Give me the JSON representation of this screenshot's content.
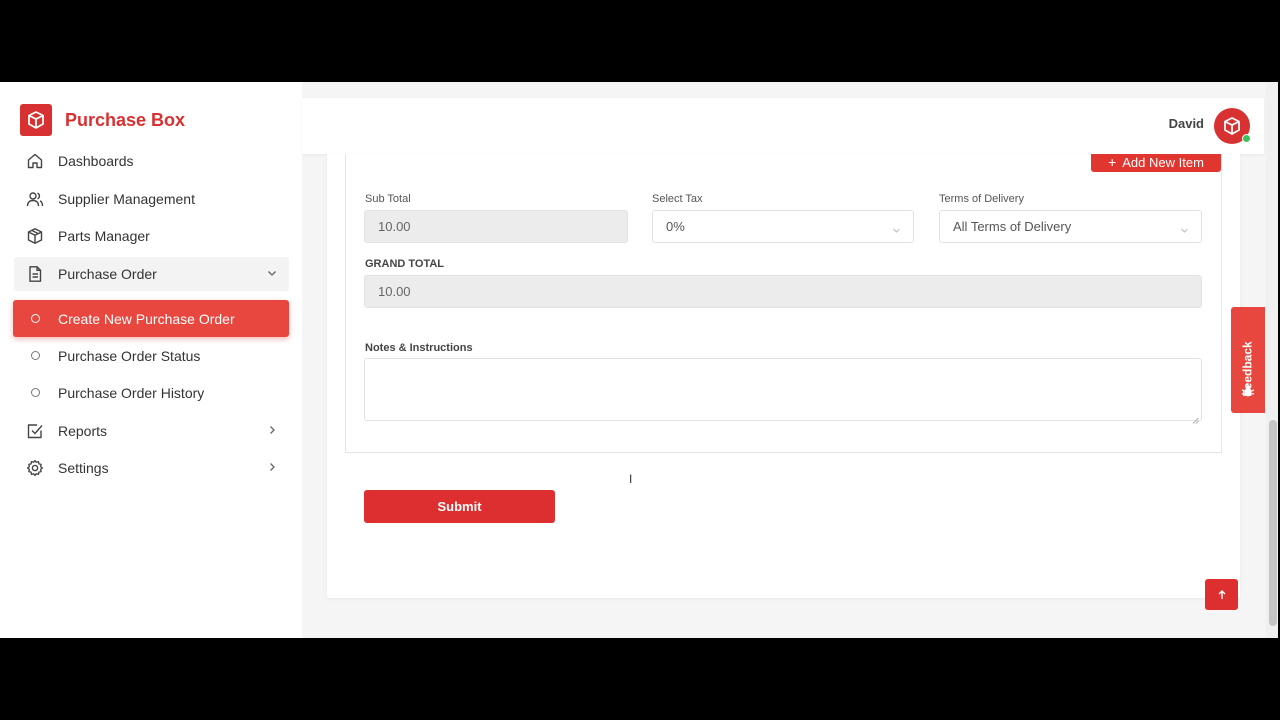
{
  "brand": {
    "name": "Purchase Box",
    "color": "#d83131"
  },
  "sidebar": {
    "items": [
      {
        "label": "Dashboards",
        "icon": "home-icon"
      },
      {
        "label": "Supplier Management",
        "icon": "users-icon"
      },
      {
        "label": "Parts Manager",
        "icon": "box-icon"
      },
      {
        "label": "Purchase Order",
        "icon": "document-icon",
        "expanded": true
      },
      {
        "label": "Reports",
        "icon": "checkbox-icon"
      },
      {
        "label": "Settings",
        "icon": "gear-icon"
      }
    ],
    "purchase_order_sub": [
      {
        "label": "Create New Purchase Order",
        "active": true
      },
      {
        "label": "Purchase Order Status",
        "active": false
      },
      {
        "label": "Purchase Order History",
        "active": false
      }
    ]
  },
  "header": {
    "user": "David"
  },
  "form": {
    "add_item_label": "Add New Item",
    "subtotal": {
      "label": "Sub Total",
      "value": "10.00"
    },
    "tax": {
      "label": "Select Tax",
      "value": "0%"
    },
    "delivery": {
      "label": "Terms of Delivery",
      "value": "All Terms of Delivery"
    },
    "grand_total": {
      "label": "GRAND TOTAL",
      "value": "10.00"
    },
    "notes": {
      "label": "Notes & Instructions",
      "value": ""
    },
    "submit_label": "Submit"
  },
  "feedback_label": "Feedback",
  "colors": {
    "accent": "#e8473f",
    "button": "#dd2f2f",
    "online": "#3cc35a"
  }
}
